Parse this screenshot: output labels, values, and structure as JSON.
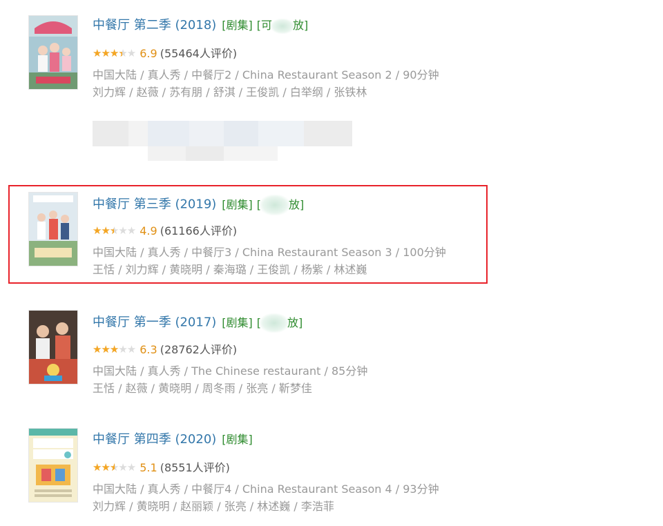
{
  "items": [
    {
      "title": "中餐厅 第二季 (2018)",
      "tag": "[剧集]",
      "tag2_left": "[可",
      "tag2_right": "放]",
      "rating_fraction": 0.69,
      "score": "6.9",
      "count": "(55464人评价)",
      "meta": "中国大陆 / 真人秀 / 中餐厅2 / China Restaurant Season 2 / 90分钟",
      "cast": "刘力辉 / 赵薇 / 苏有朋 / 舒淇 / 王俊凯 / 白举纲 / 张铁林"
    },
    {
      "title": "中餐厅 第三季 (2019)",
      "tag": "[剧集]",
      "tag2_left": "[",
      "tag2_right": "放]",
      "rating_fraction": 0.49,
      "score": "4.9",
      "count": "(61166人评价)",
      "meta": "中国大陆 / 真人秀 / 中餐厅3 / China Restaurant Season 3 / 100分钟",
      "cast": "王恬 / 刘力辉 / 黄晓明 / 秦海璐 / 王俊凯 / 杨紫 / 林述巍"
    },
    {
      "title": "中餐厅 第一季 (2017)",
      "tag": "[剧集]",
      "tag2_left": "[",
      "tag2_right": "放]",
      "rating_fraction": 0.63,
      "score": "6.3",
      "count": "(28762人评价)",
      "meta": "中国大陆 / 真人秀 / The Chinese restaurant / 85分钟",
      "cast": "王恬 / 赵薇 / 黄晓明 / 周冬雨 / 张亮 / 靳梦佳"
    },
    {
      "title": "中餐厅 第四季 (2020)",
      "tag": "[剧集]",
      "rating_fraction": 0.51,
      "score": "5.1",
      "count": "(8551人评价)",
      "meta": "中国大陆 / 真人秀 / 中餐厅4 / China Restaurant Season 4 / 93分钟",
      "cast": "刘力辉 / 黄晓明 / 赵丽颖 / 张亮 / 林述巍 / 李浩菲"
    }
  ],
  "stars_glyphs": "★★★★★",
  "colors": {
    "highlight": "#e8222a",
    "title": "#3377aa",
    "tag": "#2e8b2e",
    "star": "#f5a623",
    "score": "#e09015"
  }
}
